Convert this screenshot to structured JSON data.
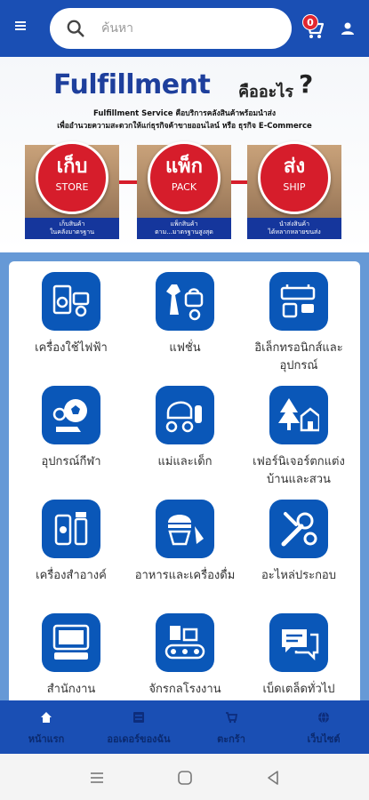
{
  "header": {
    "search_placeholder": "ค้นหา",
    "cart_count": "0"
  },
  "banner": {
    "title": "Fulfillment",
    "title_th": "คืออะไร",
    "question_mark": "?",
    "subtitle_line1": "Fulfillment Service คือบริการคลังสินค้าพร้อมนำส่ง",
    "subtitle_line2": "เพื่ออำนวยความสะดวกให้แก่ธุรกิจค้าขายออนไลน์ หรือ ธุรกิจ E-Commerce",
    "stages": [
      {
        "th": "เก็บ",
        "en": "STORE",
        "caption1": "เก็บสินค้า",
        "caption2": "ในคลังมาตรฐาน"
      },
      {
        "th": "แพ็ก",
        "en": "PACK",
        "caption1": "แพ็กสินค้า",
        "caption2": "ตาม...มาตรฐานสูงสุด"
      },
      {
        "th": "ส่ง",
        "en": "SHIP",
        "caption1": "นำส่งสินค้า",
        "caption2": "ได้หลากหลายขนส่ง"
      }
    ]
  },
  "categories": [
    {
      "label": "เครื่องใช้ไฟฟ้า",
      "icon": "appliance-icon"
    },
    {
      "label": "แฟชั่น",
      "icon": "fashion-icon"
    },
    {
      "label": "อิเล็กทรอนิกส์และอุปกรณ์",
      "icon": "electronics-icon"
    },
    {
      "label": "อุปกรณ์กีฬา",
      "icon": "sports-icon"
    },
    {
      "label": "แม่และเด็ก",
      "icon": "baby-stroller-icon"
    },
    {
      "label": "เฟอร์นิเจอร์ตกแต่งบ้านและสวน",
      "icon": "home-garden-icon"
    },
    {
      "label": "เครื่องสำอางค์",
      "icon": "cosmetics-icon"
    },
    {
      "label": "อาหารและเครื่องดื่ม",
      "icon": "food-drink-icon"
    },
    {
      "label": "อะไหล่ประกอบ",
      "icon": "tools-icon"
    },
    {
      "label": "สำนักงาน",
      "icon": "office-icon"
    },
    {
      "label": "จักรกลโรงงาน",
      "icon": "factory-machine-icon"
    },
    {
      "label": "เบ็ดเตล็ดทั่วไป",
      "icon": "chat-bubble-icon"
    }
  ],
  "bottom_nav": [
    {
      "label": "หน้าแรก",
      "icon": "home-icon"
    },
    {
      "label": "ออเดอร์ของฉัน",
      "icon": "orders-icon"
    },
    {
      "label": "ตะกร้า",
      "icon": "cart-icon"
    },
    {
      "label": "เว็บไซต์",
      "icon": "globe-icon"
    }
  ],
  "colors": {
    "primary": "#1a4fb4",
    "category_tile": "#0a57b8",
    "accent_red": "#d61d2b",
    "panel_border": "#6699d6"
  }
}
